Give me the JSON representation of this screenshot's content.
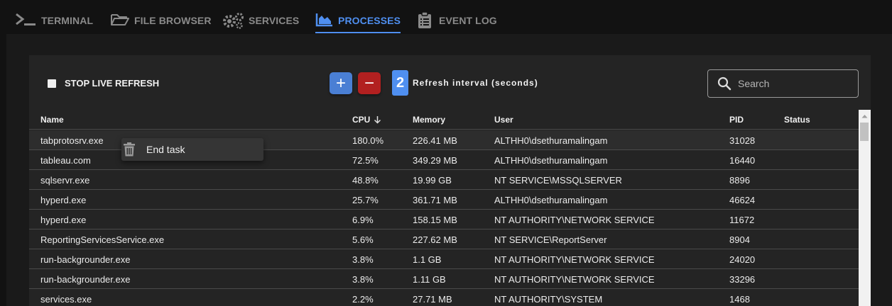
{
  "tabs": [
    {
      "label": "TERMINAL",
      "icon": "terminal-icon",
      "active": false
    },
    {
      "label": "FILE BROWSER",
      "icon": "folder-open-icon",
      "active": false
    },
    {
      "label": "SERVICES",
      "icon": "gears-icon",
      "active": false
    },
    {
      "label": "PROCESSES",
      "icon": "area-chart-icon",
      "active": true
    },
    {
      "label": "EVENT LOG",
      "icon": "clipboard-list-icon",
      "active": false
    }
  ],
  "toolbar": {
    "stop_refresh_label": "STOP LIVE REFRESH",
    "plus_label": "+",
    "minus_label": "−",
    "interval_value": "2",
    "interval_label": "Refresh interval (seconds)",
    "search_placeholder": "Search"
  },
  "columns": {
    "name": "Name",
    "cpu": "CPU",
    "memory": "Memory",
    "user": "User",
    "pid": "PID",
    "status": "Status"
  },
  "sort": {
    "column": "CPU",
    "direction": "descending"
  },
  "rows": [
    {
      "name": "tabprotosrv.exe",
      "cpu": "180.0%",
      "memory": "226.41 MB",
      "user": "ALTHH0\\dsethuramalingam",
      "pid": "31028",
      "status": ""
    },
    {
      "name": "tableau.com",
      "cpu": "72.5%",
      "memory": "349.29 MB",
      "user": "ALTHH0\\dsethuramalingam",
      "pid": "16440",
      "status": ""
    },
    {
      "name": "sqlservr.exe",
      "cpu": "48.8%",
      "memory": "19.99 GB",
      "user": "NT SERVICE\\MSSQLSERVER",
      "pid": "8896",
      "status": ""
    },
    {
      "name": "hyperd.exe",
      "cpu": "25.7%",
      "memory": "361.71 MB",
      "user": "ALTHH0\\dsethuramalingam",
      "pid": "46624",
      "status": ""
    },
    {
      "name": "hyperd.exe",
      "cpu": "6.9%",
      "memory": "158.15 MB",
      "user": "NT AUTHORITY\\NETWORK SERVICE",
      "pid": "11672",
      "status": ""
    },
    {
      "name": "ReportingServicesService.exe",
      "cpu": "5.6%",
      "memory": "227.62 MB",
      "user": "NT SERVICE\\ReportServer",
      "pid": "8904",
      "status": ""
    },
    {
      "name": "run-backgrounder.exe",
      "cpu": "3.8%",
      "memory": "1.1 GB",
      "user": "NT AUTHORITY\\NETWORK SERVICE",
      "pid": "24020",
      "status": ""
    },
    {
      "name": "run-backgrounder.exe",
      "cpu": "3.8%",
      "memory": "1.11 GB",
      "user": "NT AUTHORITY\\NETWORK SERVICE",
      "pid": "33296",
      "status": ""
    },
    {
      "name": "services.exe",
      "cpu": "2.2%",
      "memory": "27.71 MB",
      "user": "NT AUTHORITY\\SYSTEM",
      "pid": "1468",
      "status": ""
    }
  ],
  "context_menu": {
    "item_label": "End task",
    "icon": "trash-icon"
  },
  "colors": {
    "accent": "#4f8ff0",
    "danger": "#b22020",
    "background": "#121212",
    "panel": "#242424"
  }
}
